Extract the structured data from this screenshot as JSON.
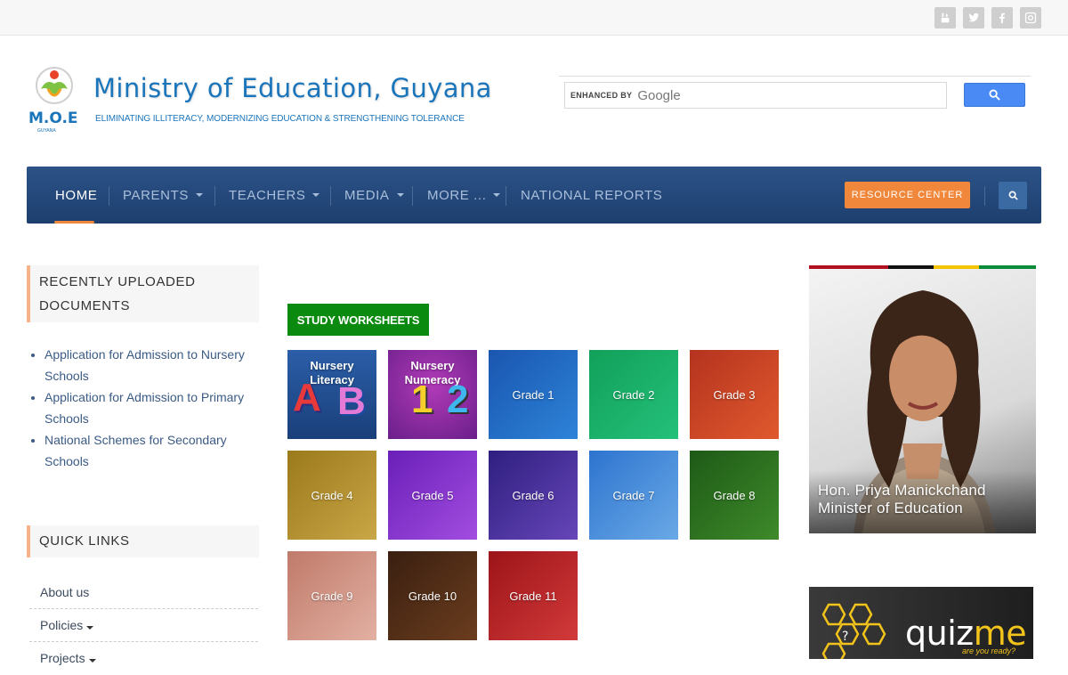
{
  "social": {
    "icons": [
      "youtube-icon",
      "twitter-icon",
      "facebook-icon",
      "instagram-icon"
    ]
  },
  "header": {
    "title": "Ministry of Education, Guyana",
    "tagline": "ELIMINATING ILLITERACY, MODERNIZING EDUCATION & STRENGTHENING TOLERANCE",
    "logo_text": "M.O.E"
  },
  "search": {
    "enhanced_label": "ENHANCED BY",
    "provider": "Google"
  },
  "nav": {
    "items": [
      {
        "label": "HOME"
      },
      {
        "label": "PARENTS"
      },
      {
        "label": "TEACHERS"
      },
      {
        "label": "MEDIA"
      },
      {
        "label": "MORE ..."
      },
      {
        "label": "NATIONAL REPORTS"
      }
    ],
    "resource_label": "RESOURCE CENTER",
    "accent": "#f0873a",
    "bar_color": "#254a7d"
  },
  "sidebar": {
    "docs_heading_line1": "RECENTLY UPLOADED",
    "docs_heading_line2": "DOCUMENTS",
    "documents": [
      "Application for Admission to Nursery Schools",
      "Application for Admission to Primary Schools",
      "National Schemes for Secondary Schools"
    ],
    "quick_heading": "QUICK LINKS",
    "quick_links": [
      "About us",
      "Policies",
      "Projects"
    ]
  },
  "worksheets": {
    "badge": "STUDY WORKSHEETS",
    "nursery_literacy_line1": "Nursery",
    "nursery_literacy_line2": "Literacy",
    "nursery_literacy_letters": [
      "A",
      "B"
    ],
    "nursery_numeracy_line1": "Nursery",
    "nursery_numeracy_line2": "Numeracy",
    "nursery_numeracy_digits": [
      "1",
      "2"
    ],
    "grades": [
      "Grade 1",
      "Grade 2",
      "Grade 3",
      "Grade 4",
      "Grade 5",
      "Grade 6",
      "Grade 7",
      "Grade 8",
      "Grade 9",
      "Grade 10",
      "Grade 11"
    ]
  },
  "minister": {
    "name": "Hon. Priya Manickchand",
    "role": "Minister of Education"
  },
  "quizme": {
    "word_a": "quiz",
    "word_b": "me",
    "sub": "are you ready?"
  }
}
